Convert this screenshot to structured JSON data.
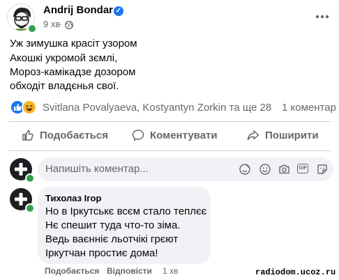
{
  "post": {
    "author": "Andrij Bondar",
    "time": "9 хв",
    "separator": "·",
    "lines": [
      "Уж зимушка красіт узором",
      "Акошкі укромой зємлі,",
      "Мороз-камікадзе дозором",
      "обходіт владєнья свої."
    ]
  },
  "reactions": {
    "names": "Svitlana Povalyaeva, Kostyantyn Zorkin та ще 28",
    "comments_count": "1 коментар"
  },
  "actions": {
    "like": "Подобається",
    "comment": "Коментувати",
    "share": "Поширити"
  },
  "composer": {
    "placeholder": "Напишіть коментар...",
    "gif_label": "GIF"
  },
  "comment": {
    "author": "Тихолаз Ігор",
    "lines": [
      "Но в Іркутськє всєм стало теплєє",
      "Нє спешит туда что-то зіма.",
      "Ведь ваєнніє льотчікі грєют",
      "Іркутчан простиє дома!"
    ],
    "like": "Подобається",
    "reply": "Відповісти",
    "time": "1 хв"
  },
  "watermark": "radiodom.ucoz.ru",
  "colors": {
    "accent": "#1877f2",
    "secondary_text": "#65676b",
    "bubble": "#f0f2f5",
    "online": "#31a24c"
  }
}
